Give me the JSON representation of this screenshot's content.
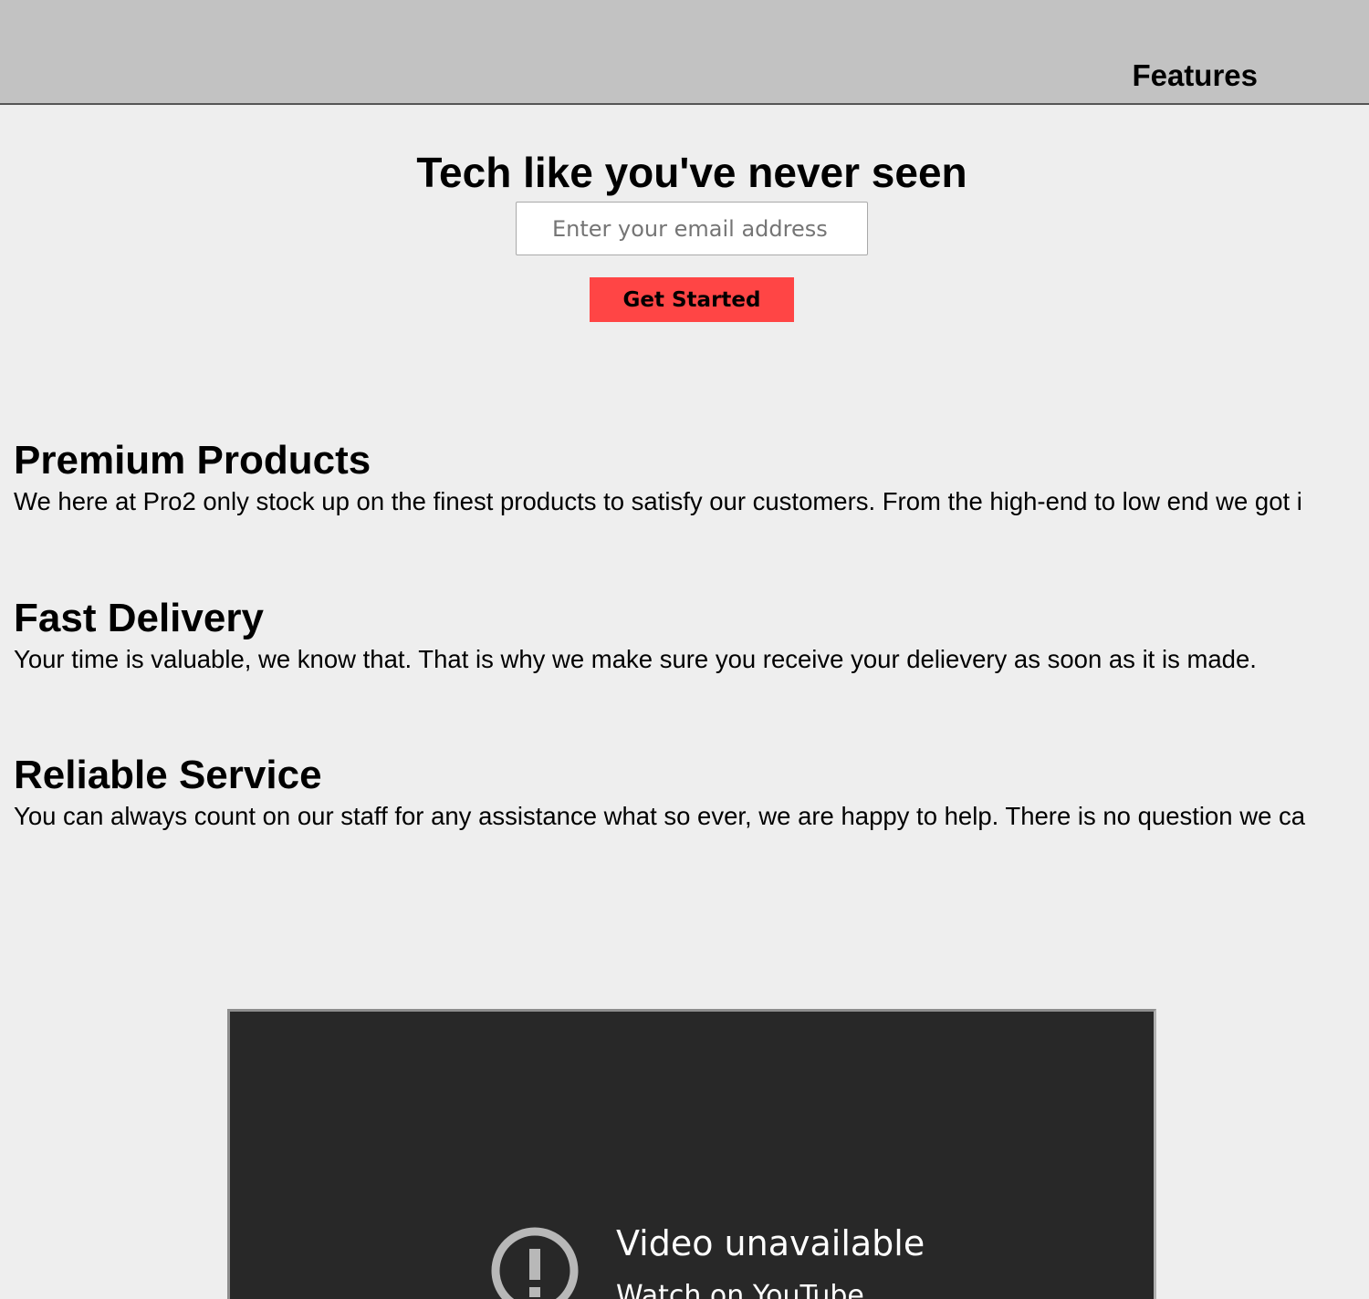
{
  "header": {
    "nav_label": "Features"
  },
  "hero": {
    "title": "Tech like you've never seen",
    "email_placeholder": "Enter your email address",
    "cta_label": "Get Started",
    "cta_color": "#ff4545"
  },
  "features": [
    {
      "title": "Premium Products",
      "text": "We here at Pro2 only stock up on the finest products to satisfy our customers. From the high-end to low end we got i"
    },
    {
      "title": "Fast Delivery",
      "text": "Your time is valuable, we know that. That is why we make sure you receive your delievery as soon as it is made."
    },
    {
      "title": "Reliable Service",
      "text": "You can always count on our staff for any assistance what so ever, we are happy to help. There is no question we ca"
    }
  ],
  "video": {
    "title": "Video unavailable",
    "link_label": "Watch on YouTube",
    "icon": "error-circle-icon"
  },
  "colors": {
    "header_bg": "#c2c2c2",
    "page_bg": "#eeeeee",
    "video_bg": "#282828"
  }
}
